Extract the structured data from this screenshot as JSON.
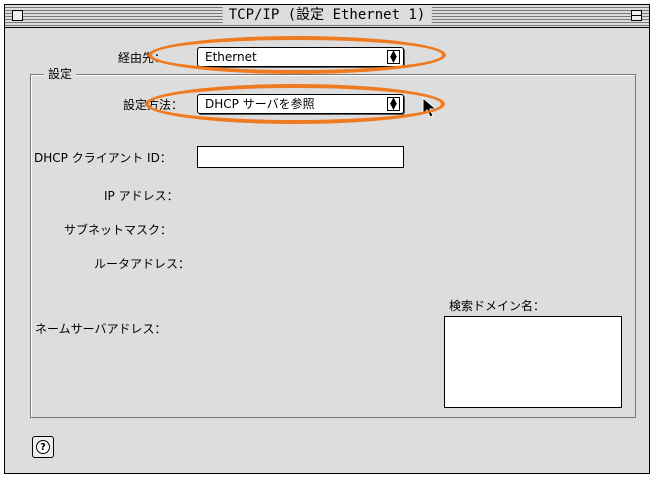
{
  "window": {
    "title": "TCP/IP (設定 Ethernet 1)"
  },
  "connect_via": {
    "label": "経由先：",
    "value": "Ethernet"
  },
  "settings_group": {
    "title": "設定"
  },
  "configure": {
    "label": "設定方法：",
    "value": "DHCP サーバを参照"
  },
  "dhcp_client_id": {
    "label": "DHCP クライアント ID：",
    "value": ""
  },
  "ip_address": {
    "label": "IP アドレス："
  },
  "subnet_mask": {
    "label": "サブネットマスク："
  },
  "router_address": {
    "label": "ルータアドレス："
  },
  "name_server": {
    "label": "ネームサーバアドレス："
  },
  "search_domains": {
    "label": "検索ドメイン名："
  },
  "help_button": {
    "label": "?"
  },
  "highlight_color": "#f07a1f",
  "icons": [
    "close-box-icon",
    "zoom-box-icon",
    "popup-arrows-icon",
    "pointer-cursor-icon",
    "help-icon"
  ]
}
